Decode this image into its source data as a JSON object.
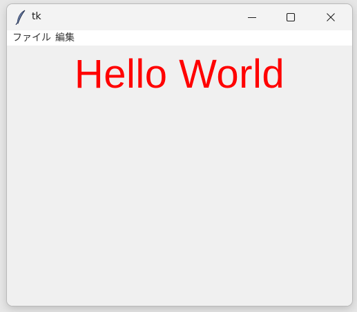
{
  "window": {
    "title": "tk"
  },
  "menubar": {
    "file_label": "ファイル",
    "edit_label": "編集"
  },
  "content": {
    "label_text": "Hello World",
    "label_color": "#ff0000"
  },
  "icons": {
    "app": "feather-icon",
    "minimize": "minimize-icon",
    "maximize": "maximize-icon",
    "close": "close-icon"
  }
}
